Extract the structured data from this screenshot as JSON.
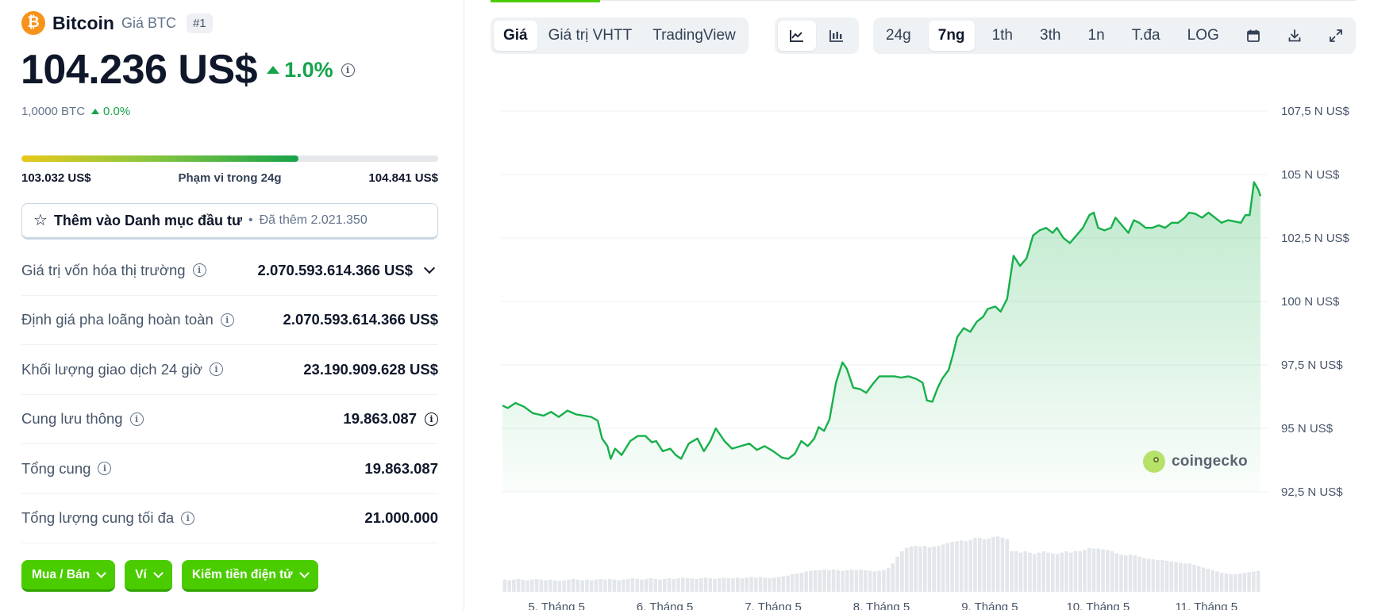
{
  "coin": {
    "name": "Bitcoin",
    "sub": "Giá BTC",
    "rank": "#1",
    "logo": "₿",
    "price": "104.236 US$",
    "change": "1.0%",
    "btc_value": "1,0000 BTC",
    "btc_change": "0.0%"
  },
  "range": {
    "low": "103.032 US$",
    "label": "Phạm vi trong 24g",
    "high": "104.841 US$",
    "position": 0.665
  },
  "watchlist": {
    "label": "Thêm vào Danh mục đầu tư",
    "sep": "•",
    "added": "Đã thêm 2.021.350"
  },
  "stats": [
    {
      "label": "Giá trị vốn hóa thị trường",
      "value": "2.070.593.614.366 US$"
    },
    {
      "label": "Định giá pha loãng hoàn toàn",
      "value": "2.070.593.614.366 US$"
    },
    {
      "label": "Khối lượng giao dịch 24 giờ",
      "value": "23.190.909.628 US$"
    },
    {
      "label": "Cung lưu thông",
      "value": "19.863.087"
    },
    {
      "label": "Tổng cung",
      "value": "19.863.087"
    },
    {
      "label": "Tổng lượng cung tối đa",
      "value": "21.000.000"
    }
  ],
  "actions": {
    "buy_sell": "Mua / Bán",
    "wallet": "Ví",
    "earn": "Kiếm tiền điện tử"
  },
  "chart_tabs": {
    "price": "Giá",
    "market_cap": "Giá trị VHTT",
    "tradingview": "TradingView"
  },
  "ranges": {
    "r24h": "24g",
    "r7d": "7ng",
    "r1m": "1th",
    "r3m": "3th",
    "r1y": "1n",
    "max": "T.đa",
    "log": "LOG"
  },
  "icons": {
    "line_chart": "line-chart-icon",
    "candle_chart": "candlestick-icon",
    "calendar": "calendar-icon",
    "download": "download-icon",
    "fullscreen": "fullscreen-icon",
    "info": "info-icon"
  },
  "colors": {
    "accent_green": "#4bcc00",
    "up_green": "#16a34a",
    "line": "#16b04a",
    "btc_orange": "#f7931a"
  },
  "watermark": "coingecko",
  "chart_data": {
    "type": "area",
    "ylim": [
      92500,
      107500
    ],
    "y_ticks": [
      "107,5 N US$",
      "105 N US$",
      "102,5 N US$",
      "100 N US$",
      "97,5 N US$",
      "95 N US$",
      "92,5 N US$"
    ],
    "y_tick_values": [
      107500,
      105000,
      102500,
      100000,
      97500,
      95000,
      92500
    ],
    "x_ticks": [
      "5. Tháng 5",
      "6. Tháng 5",
      "7. Tháng 5",
      "8. Tháng 5",
      "9. Tháng 5",
      "10. Tháng 5",
      "11. Tháng 5"
    ],
    "x_tick_positions": [
      0.5,
      1.5,
      2.5,
      3.5,
      4.5,
      5.5,
      6.5
    ],
    "x_range": [
      0,
      7
    ],
    "price": [
      [
        0.0,
        95900
      ],
      [
        0.05,
        95800
      ],
      [
        0.12,
        96000
      ],
      [
        0.2,
        95850
      ],
      [
        0.28,
        95600
      ],
      [
        0.38,
        95500
      ],
      [
        0.45,
        95650
      ],
      [
        0.52,
        95450
      ],
      [
        0.6,
        95700
      ],
      [
        0.68,
        95550
      ],
      [
        0.75,
        95500
      ],
      [
        0.82,
        95450
      ],
      [
        0.88,
        95300
      ],
      [
        0.92,
        94600
      ],
      [
        0.97,
        94300
      ],
      [
        1.0,
        93800
      ],
      [
        1.04,
        94200
      ],
      [
        1.1,
        93950
      ],
      [
        1.18,
        94500
      ],
      [
        1.25,
        94700
      ],
      [
        1.32,
        94700
      ],
      [
        1.38,
        94450
      ],
      [
        1.42,
        94500
      ],
      [
        1.48,
        94100
      ],
      [
        1.55,
        94200
      ],
      [
        1.6,
        93950
      ],
      [
        1.65,
        93800
      ],
      [
        1.72,
        94400
      ],
      [
        1.8,
        94600
      ],
      [
        1.86,
        94100
      ],
      [
        1.92,
        94500
      ],
      [
        1.97,
        95000
      ],
      [
        2.05,
        94500
      ],
      [
        2.12,
        94200
      ],
      [
        2.2,
        94300
      ],
      [
        2.28,
        94400
      ],
      [
        2.35,
        94150
      ],
      [
        2.42,
        94300
      ],
      [
        2.5,
        94100
      ],
      [
        2.58,
        93850
      ],
      [
        2.64,
        93800
      ],
      [
        2.7,
        94000
      ],
      [
        2.76,
        94500
      ],
      [
        2.82,
        94300
      ],
      [
        2.88,
        94600
      ],
      [
        2.92,
        95050
      ],
      [
        2.97,
        94900
      ],
      [
        3.02,
        95350
      ],
      [
        3.08,
        96800
      ],
      [
        3.14,
        97600
      ],
      [
        3.18,
        97350
      ],
      [
        3.24,
        96600
      ],
      [
        3.3,
        96550
      ],
      [
        3.36,
        96400
      ],
      [
        3.42,
        96750
      ],
      [
        3.48,
        97050
      ],
      [
        3.55,
        97050
      ],
      [
        3.62,
        97050
      ],
      [
        3.68,
        97000
      ],
      [
        3.75,
        97050
      ],
      [
        3.82,
        96950
      ],
      [
        3.88,
        96800
      ],
      [
        3.92,
        96100
      ],
      [
        3.97,
        96050
      ],
      [
        4.02,
        96600
      ],
      [
        4.06,
        96950
      ],
      [
        4.12,
        97300
      ],
      [
        4.16,
        97900
      ],
      [
        4.2,
        98600
      ],
      [
        4.26,
        98950
      ],
      [
        4.32,
        98800
      ],
      [
        4.38,
        99200
      ],
      [
        4.44,
        99400
      ],
      [
        4.48,
        99700
      ],
      [
        4.55,
        99800
      ],
      [
        4.6,
        99600
      ],
      [
        4.66,
        100100
      ],
      [
        4.72,
        101800
      ],
      [
        4.78,
        101400
      ],
      [
        4.84,
        101700
      ],
      [
        4.9,
        102600
      ],
      [
        4.96,
        102800
      ],
      [
        5.02,
        102900
      ],
      [
        5.08,
        102700
      ],
      [
        5.12,
        102900
      ],
      [
        5.18,
        102500
      ],
      [
        5.24,
        102300
      ],
      [
        5.3,
        102600
      ],
      [
        5.36,
        102900
      ],
      [
        5.42,
        103400
      ],
      [
        5.46,
        103500
      ],
      [
        5.5,
        102900
      ],
      [
        5.56,
        102800
      ],
      [
        5.62,
        102900
      ],
      [
        5.66,
        103300
      ],
      [
        5.72,
        103000
      ],
      [
        5.78,
        102700
      ],
      [
        5.83,
        103200
      ],
      [
        5.88,
        103100
      ],
      [
        5.94,
        102900
      ],
      [
        6.0,
        102900
      ],
      [
        6.06,
        103000
      ],
      [
        6.12,
        102900
      ],
      [
        6.18,
        103100
      ],
      [
        6.24,
        103100
      ],
      [
        6.3,
        103300
      ],
      [
        6.34,
        103500
      ],
      [
        6.4,
        103450
      ],
      [
        6.46,
        103300
      ],
      [
        6.52,
        103500
      ],
      [
        6.58,
        103300
      ],
      [
        6.64,
        103100
      ],
      [
        6.7,
        103200
      ],
      [
        6.76,
        103150
      ],
      [
        6.82,
        103100
      ],
      [
        6.86,
        103400
      ],
      [
        6.9,
        103400
      ],
      [
        6.94,
        104700
      ],
      [
        6.98,
        104400
      ],
      [
        7.0,
        104150
      ]
    ],
    "volume_relative": [
      0.18,
      0.17,
      0.18,
      0.19,
      0.18,
      0.17,
      0.18,
      0.19,
      0.18,
      0.17,
      0.18,
      0.17,
      0.16,
      0.17,
      0.18,
      0.19,
      0.18,
      0.17,
      0.18,
      0.17,
      0.18,
      0.19,
      0.18,
      0.19,
      0.18,
      0.17,
      0.18,
      0.19,
      0.2,
      0.19,
      0.18,
      0.19,
      0.2,
      0.19,
      0.18,
      0.19,
      0.2,
      0.19,
      0.2,
      0.21,
      0.2,
      0.2,
      0.19,
      0.2,
      0.21,
      0.2,
      0.19,
      0.2,
      0.21,
      0.2,
      0.2,
      0.21,
      0.2,
      0.21,
      0.22,
      0.21,
      0.22,
      0.21,
      0.2,
      0.21,
      0.22,
      0.23,
      0.24,
      0.26,
      0.27,
      0.28,
      0.3,
      0.31,
      0.32,
      0.32,
      0.33,
      0.32,
      0.33,
      0.32,
      0.31,
      0.32,
      0.33,
      0.32,
      0.33,
      0.32,
      0.31,
      0.3,
      0.31,
      0.32,
      0.35,
      0.42,
      0.52,
      0.6,
      0.65,
      0.67,
      0.68,
      0.67,
      0.68,
      0.66,
      0.67,
      0.68,
      0.7,
      0.72,
      0.74,
      0.75,
      0.76,
      0.75,
      0.77,
      0.8,
      0.8,
      0.78,
      0.79,
      0.81,
      0.82,
      0.8,
      0.78,
      0.6,
      0.6,
      0.58,
      0.6,
      0.58,
      0.56,
      0.58,
      0.6,
      0.58,
      0.57,
      0.56,
      0.58,
      0.6,
      0.58,
      0.6,
      0.6,
      0.62,
      0.65,
      0.64,
      0.64,
      0.63,
      0.62,
      0.6,
      0.57,
      0.55,
      0.54,
      0.55,
      0.54,
      0.52,
      0.5,
      0.49,
      0.48,
      0.47,
      0.47,
      0.46,
      0.45,
      0.44,
      0.43,
      0.42,
      0.42,
      0.4,
      0.38,
      0.36,
      0.34,
      0.32,
      0.3,
      0.28,
      0.27,
      0.26,
      0.26,
      0.27,
      0.28,
      0.29,
      0.3,
      0.31
    ]
  }
}
